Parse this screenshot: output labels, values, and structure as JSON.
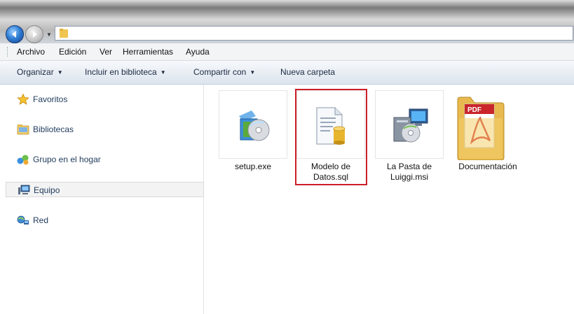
{
  "address_bar": {
    "path": ""
  },
  "menu": {
    "items": [
      {
        "label": "Archivo"
      },
      {
        "label": "Edición"
      },
      {
        "label": "Ver"
      },
      {
        "label": "Herramientas"
      },
      {
        "label": "Ayuda"
      }
    ]
  },
  "toolbar": {
    "organize": "Organizar",
    "include_library": "Incluir en biblioteca",
    "share_with": "Compartir con",
    "new_folder": "Nueva carpeta"
  },
  "sidebar": {
    "items": [
      {
        "label": "Favoritos",
        "icon": "star-icon"
      },
      {
        "label": "Bibliotecas",
        "icon": "libraries-icon"
      },
      {
        "label": "Grupo en el hogar",
        "icon": "homegroup-icon"
      },
      {
        "label": "Equipo",
        "icon": "computer-icon",
        "selected": true
      },
      {
        "label": "Red",
        "icon": "network-icon"
      }
    ]
  },
  "files": [
    {
      "name": "setup.exe",
      "icon": "installer-exe-icon"
    },
    {
      "name": "Modelo de Datos.sql",
      "icon": "sql-file-icon",
      "highlighted": true
    },
    {
      "name": "La Pasta de Luiggi.msi",
      "icon": "msi-installer-icon"
    },
    {
      "name": "Documentación",
      "icon": "pdf-folder-icon"
    }
  ],
  "colors": {
    "highlight_border": "#cc1f2a",
    "sidebar_text": "#1e395b",
    "toolbar_bg": "#e8edf4"
  }
}
